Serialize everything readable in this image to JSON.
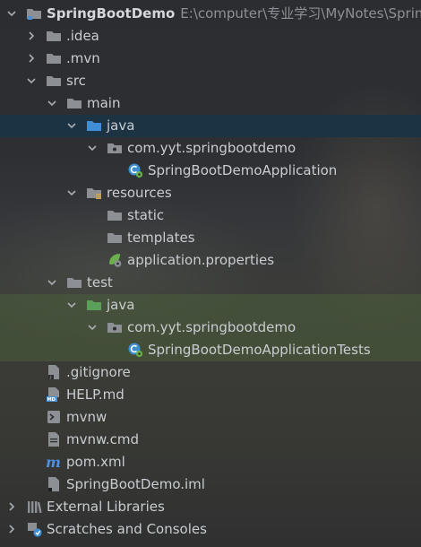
{
  "project": {
    "name": "SpringBootDemo",
    "path": "E:\\computer\\专业学习\\MyNotes\\Spring"
  },
  "tree": {
    "idea": ".idea",
    "mvn": ".mvn",
    "src": "src",
    "main": "main",
    "main_java": "java",
    "main_pkg": "com.yyt.springbootdemo",
    "main_app": "SpringBootDemoApplication",
    "resources": "resources",
    "static": "static",
    "templates": "templates",
    "app_props": "application.properties",
    "test": "test",
    "test_java": "java",
    "test_pkg": "com.yyt.springbootdemo",
    "test_app": "SpringBootDemoApplicationTests",
    "gitignore": ".gitignore",
    "help": "HELP.md",
    "mvnw": "mvnw",
    "mvnw_cmd": "mvnw.cmd",
    "pom": "pom.xml",
    "iml": "SpringBootDemo.iml",
    "ext_libs": "External Libraries",
    "scratches": "Scratches and Consoles"
  },
  "icon_colors": {
    "folder": "#8c8f94",
    "folder_blue": "#3f8fd6",
    "folder_green": "#5aa05a",
    "spring": "#6ab04c"
  }
}
